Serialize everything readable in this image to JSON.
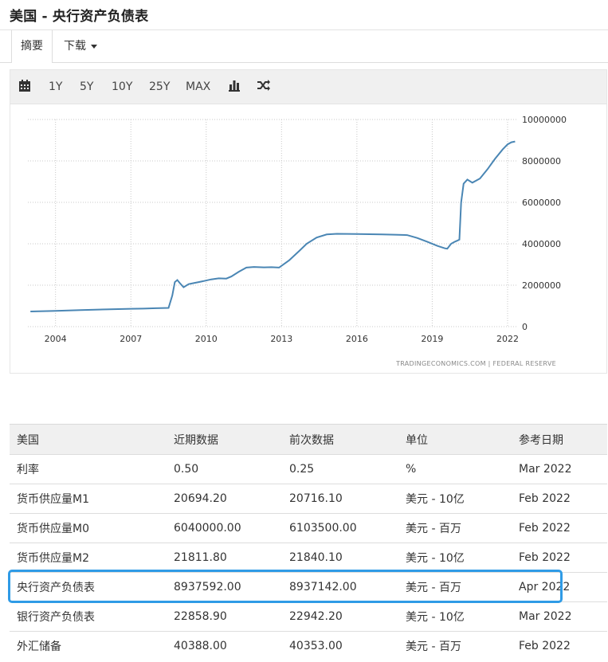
{
  "page": {
    "title": "美国 - 央行资产负债表"
  },
  "tabs": {
    "summary": "摘要",
    "download": "下载"
  },
  "toolbar": {
    "calendar_icon": "calendar-icon",
    "ranges": [
      "1Y",
      "5Y",
      "10Y",
      "25Y",
      "MAX"
    ],
    "chart_type_icon": "bar-chart-icon",
    "compare_icon": "shuffle-icon"
  },
  "chart_data": {
    "type": "line",
    "title": "",
    "xlabel": "",
    "ylabel": "",
    "x_ticks": [
      "2004",
      "2007",
      "2010",
      "2013",
      "2016",
      "2019",
      "2022"
    ],
    "y_ticks": [
      "0",
      "2000000",
      "4000000",
      "6000000",
      "8000000",
      "10000000"
    ],
    "ylim": [
      0,
      10000000
    ],
    "xlim": [
      2002.9,
      2022.35
    ],
    "grid": true,
    "line_color": "#4a86b4",
    "source_text": "TRADINGECONOMICS.COM  |  FEDERAL RESERVE",
    "series": [
      {
        "x": [
          2003.0,
          2004.0,
          2005.0,
          2006.0,
          2007.0,
          2007.5,
          2008.0,
          2008.5,
          2008.65,
          2008.75,
          2008.85,
          2008.95,
          2009.1,
          2009.3,
          2009.5,
          2009.7,
          2009.9,
          2010.2,
          2010.5,
          2010.8,
          2011.0,
          2011.3,
          2011.6,
          2011.9,
          2012.3,
          2012.6,
          2012.9,
          2013.3,
          2013.7,
          2014.0,
          2014.4,
          2014.8,
          2015.2,
          2016.0,
          2016.5,
          2017.0,
          2017.5,
          2018.0,
          2018.4,
          2018.8,
          2019.2,
          2019.5,
          2019.6,
          2019.75,
          2019.9,
          2020.0,
          2020.08,
          2020.15,
          2020.25,
          2020.4,
          2020.6,
          2020.9,
          2021.2,
          2021.5,
          2021.8,
          2022.0,
          2022.15,
          2022.3
        ],
        "y": [
          730000,
          760000,
          800000,
          830000,
          860000,
          870000,
          890000,
          905000,
          1500000,
          2150000,
          2250000,
          2100000,
          1900000,
          2050000,
          2100000,
          2150000,
          2200000,
          2280000,
          2330000,
          2320000,
          2420000,
          2650000,
          2850000,
          2880000,
          2860000,
          2870000,
          2850000,
          3200000,
          3650000,
          4000000,
          4300000,
          4450000,
          4480000,
          4470000,
          4460000,
          4450000,
          4440000,
          4420000,
          4280000,
          4100000,
          3900000,
          3780000,
          3760000,
          4000000,
          4100000,
          4150000,
          4200000,
          6000000,
          6900000,
          7100000,
          6950000,
          7150000,
          7600000,
          8100000,
          8550000,
          8800000,
          8900000,
          8940000
        ]
      }
    ]
  },
  "table": {
    "headers": [
      "美国",
      "近期数据",
      "前次数据",
      "单位",
      "参考日期"
    ],
    "rows": [
      [
        "利率",
        "0.50",
        "0.25",
        "%",
        "Mar 2022"
      ],
      [
        "货币供应量M1",
        "20694.20",
        "20716.10",
        "美元 - 10亿",
        "Feb 2022"
      ],
      [
        "货币供应量M0",
        "6040000.00",
        "6103500.00",
        "美元 - 百万",
        "Feb 2022"
      ],
      [
        "货币供应量M2",
        "21811.80",
        "21840.10",
        "美元 - 10亿",
        "Feb 2022"
      ],
      [
        "央行资产负债表",
        "8937592.00",
        "8937142.00",
        "美元 - 百万",
        "Apr 2022"
      ],
      [
        "银行资产负债表",
        "22858.90",
        "22942.20",
        "美元 - 10亿",
        "Mar 2022"
      ],
      [
        "外汇储备",
        "40388.00",
        "40353.00",
        "美元 - 百万",
        "Feb 2022"
      ]
    ],
    "highlight_color": "#2f9be6"
  }
}
